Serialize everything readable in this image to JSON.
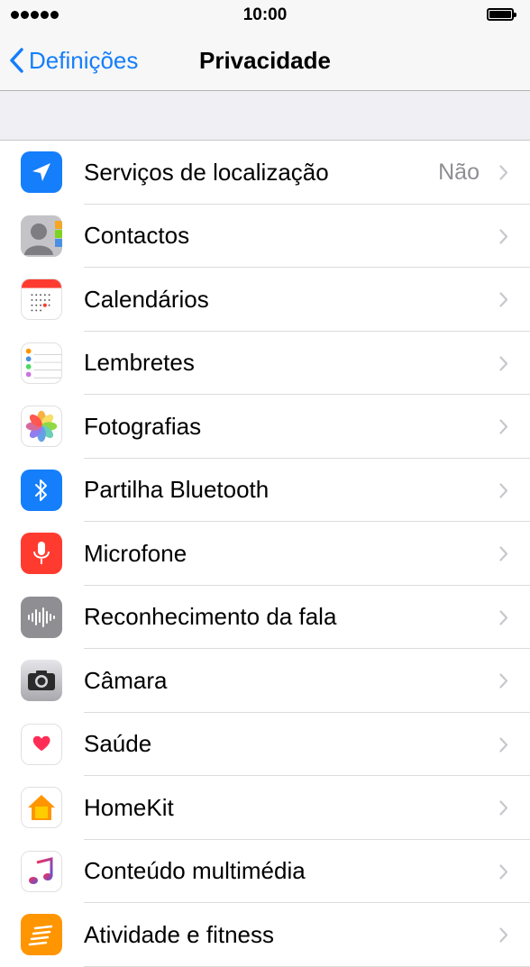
{
  "status_bar": {
    "time": "10:00"
  },
  "nav": {
    "back_label": "Definições",
    "title": "Privacidade"
  },
  "colors": {
    "accent": "#157efb",
    "secondary_text": "#8e8e93",
    "background": "#efeff4"
  },
  "items": [
    {
      "label": "Serviços de localização",
      "value": "Não",
      "icon": "location-arrow-icon"
    },
    {
      "label": "Contactos",
      "icon": "contacts-icon"
    },
    {
      "label": "Calendários",
      "icon": "calendar-icon"
    },
    {
      "label": "Lembretes",
      "icon": "reminders-icon"
    },
    {
      "label": "Fotografias",
      "icon": "photos-icon"
    },
    {
      "label": "Partilha Bluetooth",
      "icon": "bluetooth-icon"
    },
    {
      "label": "Microfone",
      "icon": "microphone-icon"
    },
    {
      "label": "Reconhecimento da fala",
      "icon": "speech-waveform-icon"
    },
    {
      "label": "Câmara",
      "icon": "camera-icon"
    },
    {
      "label": "Saúde",
      "icon": "health-heart-icon"
    },
    {
      "label": "HomeKit",
      "icon": "homekit-house-icon"
    },
    {
      "label": "Conteúdo multimédia",
      "icon": "music-note-icon"
    },
    {
      "label": "Atividade e fitness",
      "icon": "fitness-icon"
    }
  ]
}
